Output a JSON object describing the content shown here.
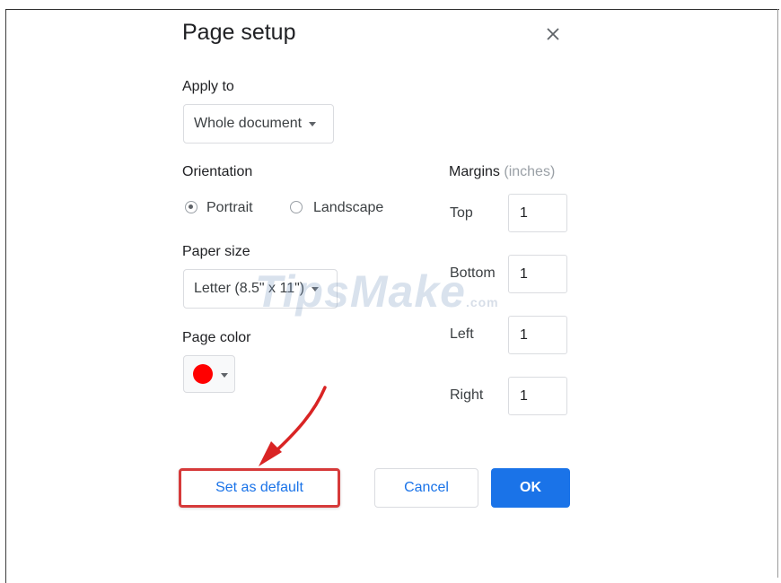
{
  "dialog": {
    "title": "Page setup",
    "apply_to": {
      "label": "Apply to",
      "value": "Whole document"
    },
    "orientation": {
      "label": "Orientation",
      "options": [
        "Portrait",
        "Landscape"
      ],
      "selected": "Portrait"
    },
    "paper_size": {
      "label": "Paper size",
      "value": "Letter (8.5\" x 11\")"
    },
    "page_color": {
      "label": "Page color",
      "color": "#ff0000"
    },
    "margins": {
      "label": "Margins",
      "unit_label": "(inches)",
      "top": {
        "label": "Top",
        "value": "1"
      },
      "bottom": {
        "label": "Bottom",
        "value": "1"
      },
      "left": {
        "label": "Left",
        "value": "1"
      },
      "right": {
        "label": "Right",
        "value": "1"
      }
    },
    "buttons": {
      "set_default": "Set as default",
      "cancel": "Cancel",
      "ok": "OK"
    }
  },
  "watermark": {
    "text": "TipsMake",
    "suffix": ".com"
  },
  "colors": {
    "accent": "#1a73e8",
    "highlight": "#d63a3a"
  }
}
